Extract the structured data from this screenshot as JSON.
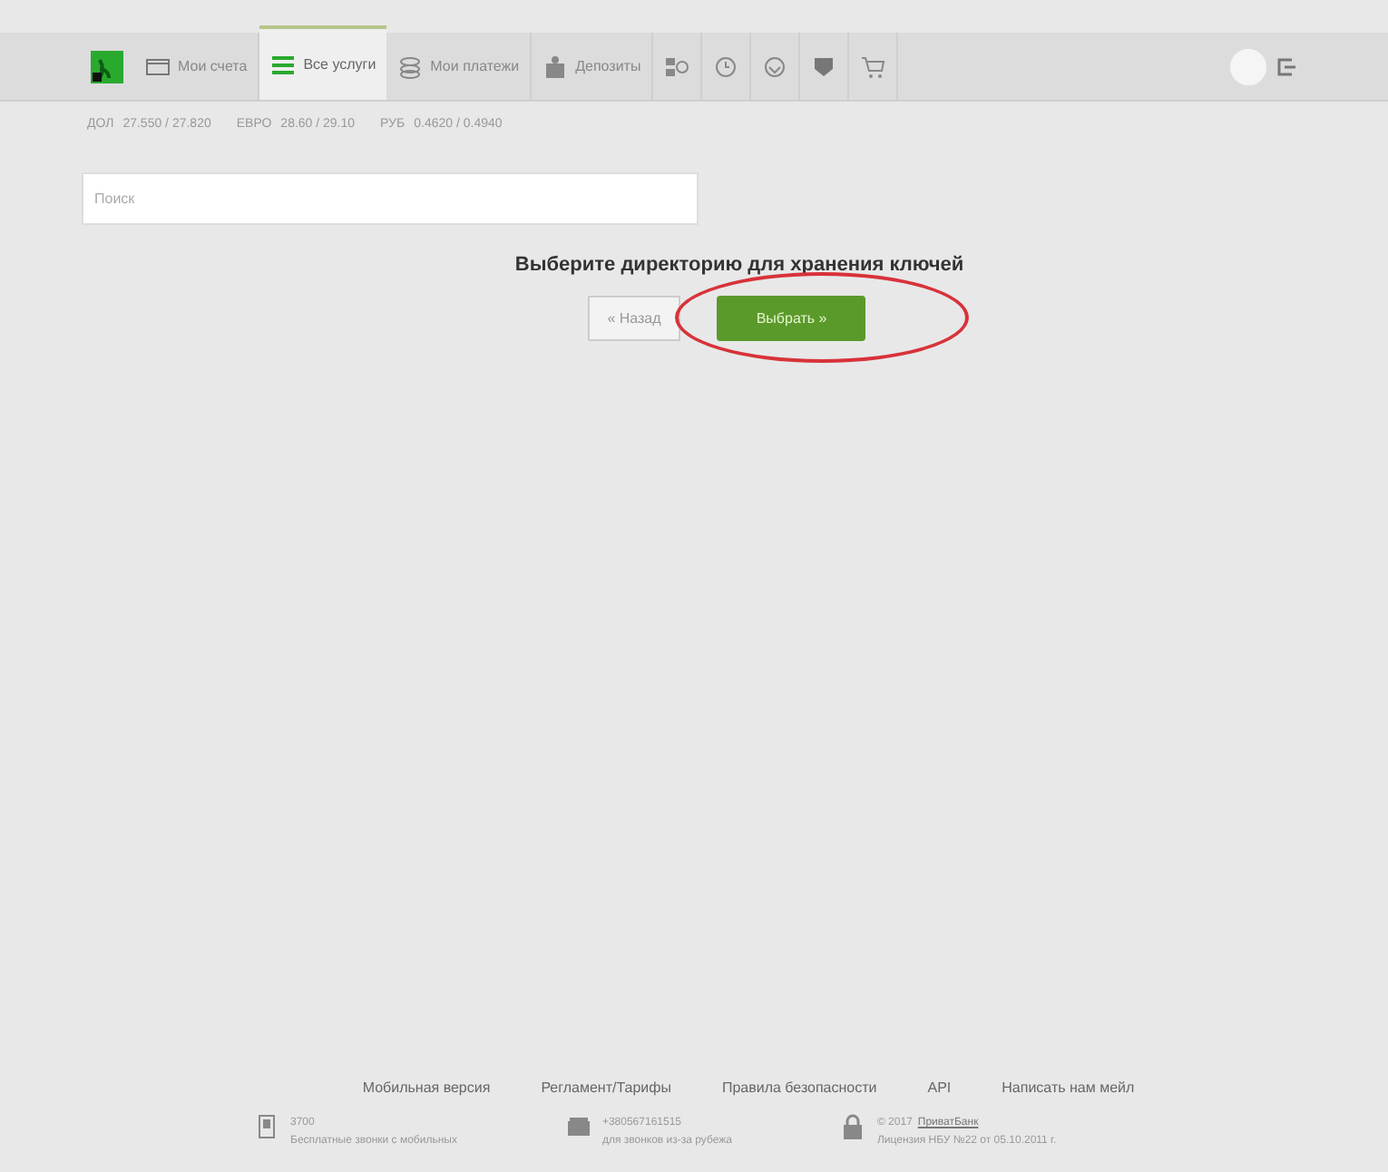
{
  "nav": {
    "tabs": [
      {
        "label": "Мои счета",
        "selected": false
      },
      {
        "label": "Все услуги",
        "selected": true
      },
      {
        "label": "Мои платежи",
        "selected": false
      },
      {
        "label": "Депозиты",
        "selected": false
      }
    ]
  },
  "rates": [
    {
      "currency": "ДОЛ",
      "value": "27.550 / 27.820"
    },
    {
      "currency": "ЕВРО",
      "value": "28.60 / 29.10"
    },
    {
      "currency": "РУБ",
      "value": "0.4620 / 0.4940"
    }
  ],
  "search": {
    "placeholder": "Поиск"
  },
  "dialog": {
    "title": "Выберите директорию для хранения ключей",
    "back": "« Назад",
    "choose": "Выбрать »",
    "choose_highlighted": true
  },
  "footer": {
    "links": [
      "Мобильная версия",
      "Регламент/Тарифы",
      "Правила безопасности",
      "API",
      "Написать нам мейл"
    ],
    "info": [
      {
        "line1": "3700",
        "line2": "Бесплатные звонки с мобильных"
      },
      {
        "line1": "+380567161515",
        "line2": "для звонков из-за рубежа"
      },
      {
        "line1": "© 2017",
        "link": "ПриватБанк",
        "line2": "Лицензия НБУ №22 от 05.10.2011 г."
      }
    ]
  }
}
